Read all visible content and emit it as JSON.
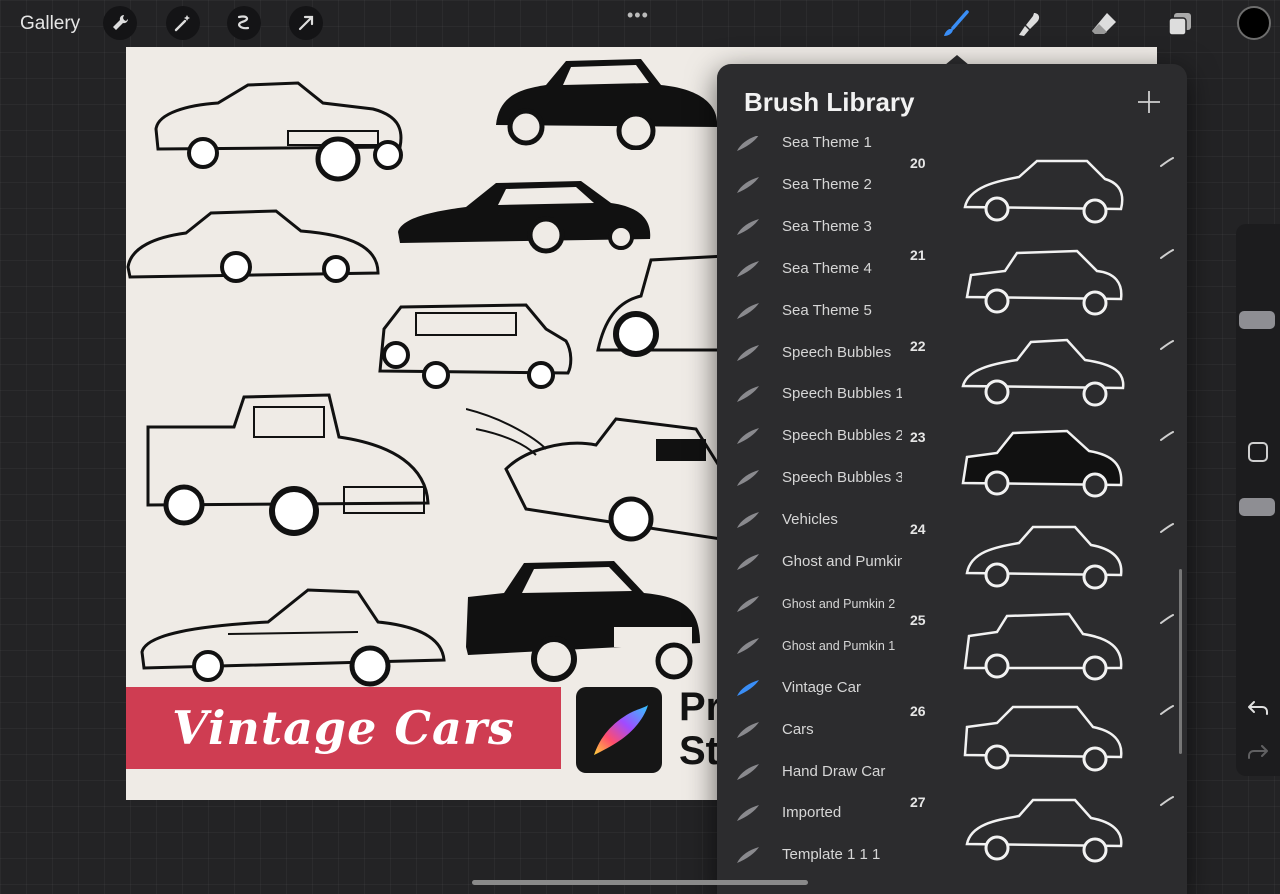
{
  "topbar": {
    "gallery_label": "Gallery",
    "left_tools": [
      "wrench-icon",
      "magic-wand-icon",
      "selection-icon",
      "transform-arrow-icon"
    ],
    "menu_dots": "•••",
    "right_tools": [
      "brush-icon",
      "smudge-icon",
      "eraser-icon",
      "layers-icon"
    ],
    "active_tool": "brush-icon",
    "current_color": "#000000"
  },
  "canvas": {
    "banner_text": "Vintage Cars",
    "promo_line1": "Pr",
    "promo_line2": "St",
    "accent_color": "#cf3d52"
  },
  "brush_library": {
    "title": "Brush Library",
    "add_icon": "plus-icon",
    "selected_set": "Vintage Car",
    "sets": [
      {
        "label": "Sea Theme 1"
      },
      {
        "label": "Sea Theme 2"
      },
      {
        "label": "Sea Theme 3"
      },
      {
        "label": "Sea Theme 4"
      },
      {
        "label": "Sea Theme 5"
      },
      {
        "label": "Speech Bubbles"
      },
      {
        "label": "Speech Bubbles 1"
      },
      {
        "label": "Speech Bubbles 2"
      },
      {
        "label": "Speech Bubbles 3"
      },
      {
        "label": "Vehicles"
      },
      {
        "label": "Ghost and Pumkin"
      },
      {
        "label": "Ghost and Pumkin 2"
      },
      {
        "label": "Ghost and Pumkin 1"
      },
      {
        "label": "Vintage Car"
      },
      {
        "label": "Cars"
      },
      {
        "label": "Hand Draw Car"
      },
      {
        "label": "Imported"
      },
      {
        "label": "Template 1 1 1"
      }
    ],
    "brushes": [
      {
        "num": ""
      },
      {
        "num": "20"
      },
      {
        "num": "21"
      },
      {
        "num": "22"
      },
      {
        "num": "23"
      },
      {
        "num": "24"
      },
      {
        "num": "25"
      },
      {
        "num": "26"
      },
      {
        "num": "27"
      }
    ]
  },
  "sidebar": {
    "undo_icon": "undo-arrow-icon",
    "redo_icon": "redo-arrow-icon"
  }
}
